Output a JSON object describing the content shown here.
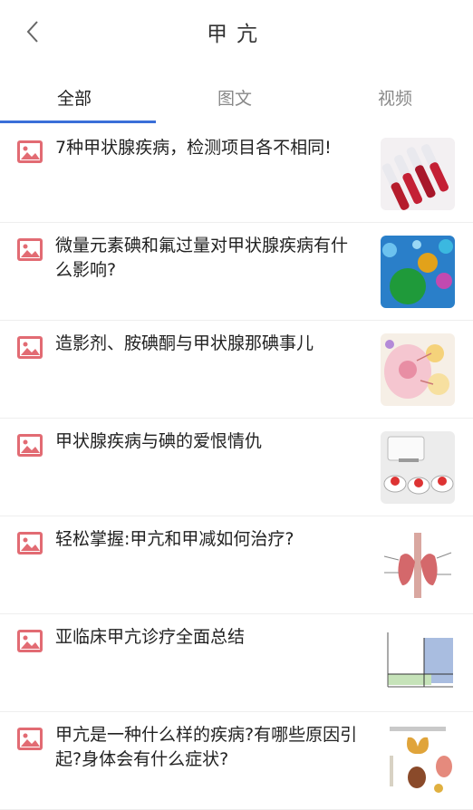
{
  "header": {
    "title": "甲亢",
    "back_icon": "chevron-left-icon"
  },
  "tabs": [
    {
      "label": "全部",
      "active": true
    },
    {
      "label": "图文",
      "active": false
    },
    {
      "label": "视频",
      "active": false
    }
  ],
  "colors": {
    "accent": "#3a6fd8",
    "article_icon": "#e26b73"
  },
  "articles": [
    {
      "title": "7种甲状腺疾病，检测项目各不相同!",
      "type_icon": "image-article-icon",
      "thumb": "test-tubes-image"
    },
    {
      "title": "微量元素碘和氟过量对甲状腺疾病有什么影响?",
      "type_icon": "image-article-icon",
      "thumb": "trace-elements-image"
    },
    {
      "title": "造影剂、胺碘酮与甲状腺那碘事儿",
      "type_icon": "image-article-icon",
      "thumb": "cell-diagram-image"
    },
    {
      "title": "甲状腺疾病与碘的爱恨情仇",
      "type_icon": "image-article-icon",
      "thumb": "iodine-salt-image"
    },
    {
      "title": "轻松掌握:甲亢和甲减如何治疗?",
      "type_icon": "image-article-icon",
      "thumb": "thyroid-anatomy-image"
    },
    {
      "title": "亚临床甲亢诊疗全面总结",
      "type_icon": "image-article-icon",
      "thumb": "quadrant-chart-image"
    },
    {
      "title": "甲亢是一种什么样的疾病?有哪些原因引起?身体会有什么症状?",
      "type_icon": "image-article-icon",
      "thumb": "thyroid-infographic-image"
    }
  ]
}
